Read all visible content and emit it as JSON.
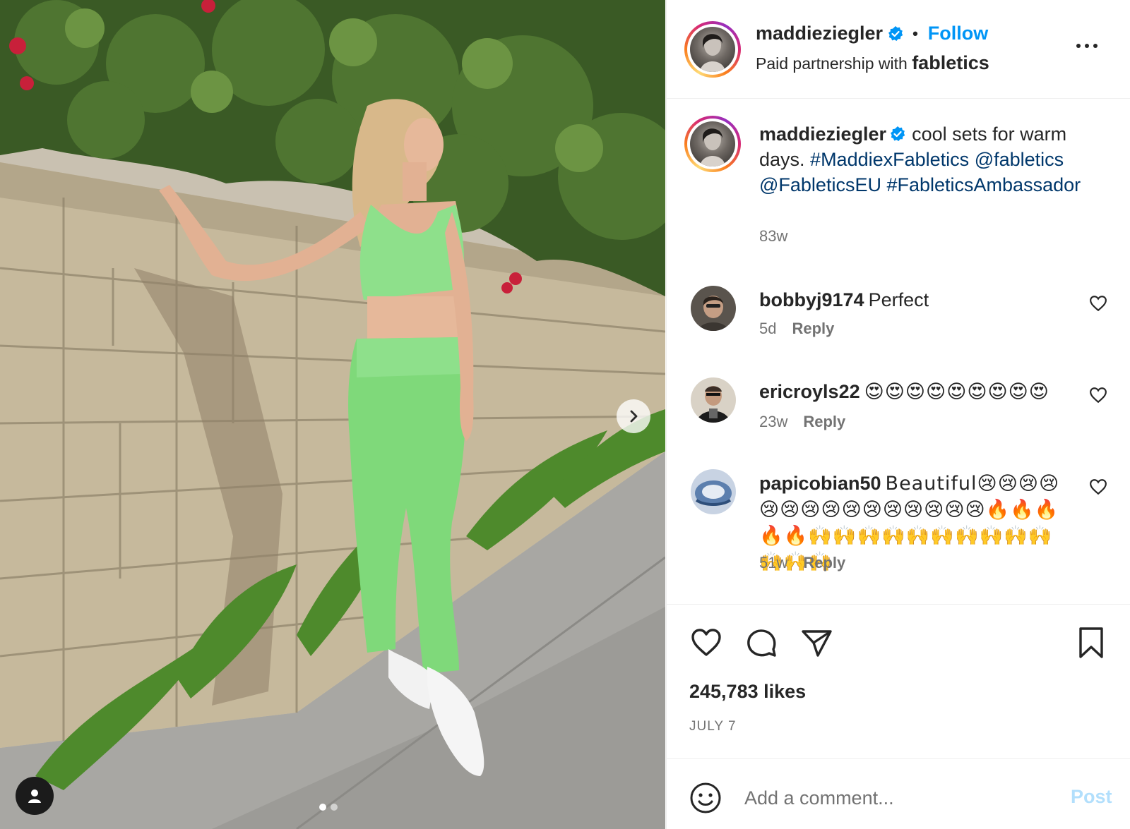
{
  "post": {
    "image_alt": "",
    "carousel": {
      "count": 2,
      "active_index": 0
    }
  },
  "header": {
    "username": "maddieziegler",
    "separator": "•",
    "follow_label": "Follow",
    "partnership_prefix": "Paid partnership with ",
    "partner": "fabletics",
    "verified_icon": "verified-badge-icon",
    "more_icon": "more-options-icon"
  },
  "caption": {
    "username": "maddieziegler",
    "text": "cool sets for warm days. ",
    "tags": [
      "#MaddiexFabletics",
      "@fabletics",
      "@FableticsEU",
      "#FableticsAmbassador"
    ],
    "time": "83w"
  },
  "comments": [
    {
      "username": "bobbyj9174",
      "text": "Perfect",
      "time": "5d",
      "reply_label": "Reply"
    },
    {
      "username": "ericroyls22",
      "text": "😍😍😍😍😍😍😍😍😍",
      "time": "23w",
      "reply_label": "Reply"
    },
    {
      "username": "papicobian50",
      "text": "Beautiful😢😢😢😢😢😢😢😢😢😢😢😢😢😢😢🔥🔥🔥🔥🔥🙌🙌🙌🙌🙌🙌🙌🙌🙌🙌🙌🙌🙌",
      "time": "51w",
      "reply_label": "Reply"
    }
  ],
  "actions": {
    "likes": "245,783 likes",
    "date": "JULY 7",
    "icons": [
      "heart-icon",
      "comment-icon",
      "share-icon",
      "bookmark-icon"
    ]
  },
  "comment_box": {
    "placeholder": "Add a comment...",
    "post_label": "Post",
    "post_color": "#b2dffc"
  },
  "colors": {
    "accent": "#0095f6",
    "link": "#00376b",
    "muted": "#737373"
  }
}
